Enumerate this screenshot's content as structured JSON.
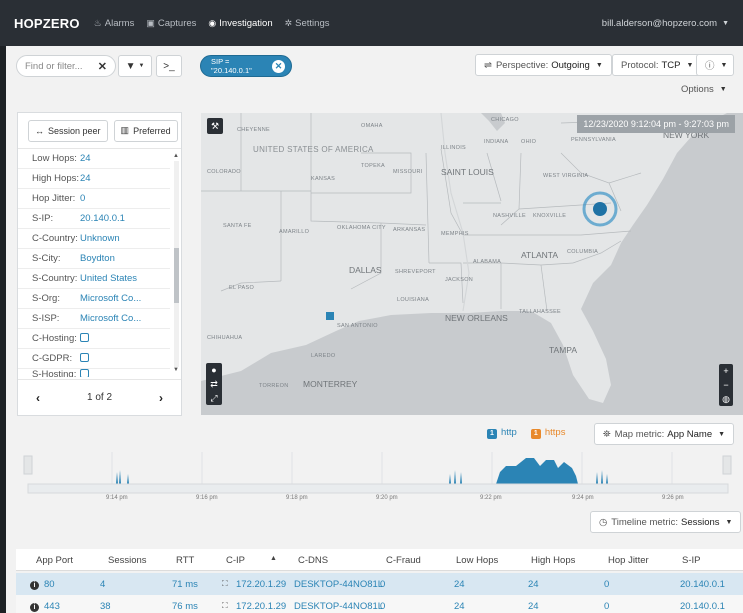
{
  "nav": {
    "brand": "HOPZERO",
    "items": [
      {
        "label": "Alarms",
        "icon": "fire-icon"
      },
      {
        "label": "Captures",
        "icon": "camera-icon"
      },
      {
        "label": "Investigation",
        "icon": "location-pin-icon",
        "active": true
      },
      {
        "label": "Settings",
        "icon": "gear-icon"
      }
    ],
    "user": "bill.alderson@hopzero.com"
  },
  "toolbar": {
    "filter_placeholder": "Find or filter...",
    "filter_chip": "SIP = \"20.140.0.1\"",
    "perspective_label": "Perspective:",
    "perspective_value": "Outgoing",
    "protocol_label": "Protocol:",
    "protocol_value": "TCP",
    "options_label": "Options"
  },
  "props": {
    "session_peer_label": "Session peer",
    "preferred_label": "Preferred",
    "rows": [
      {
        "key": "Low Hops:",
        "value": "24"
      },
      {
        "key": "High Hops:",
        "value": "24"
      },
      {
        "key": "Hop Jitter:",
        "value": "0"
      },
      {
        "key": "S-IP:",
        "value": "20.140.0.1"
      },
      {
        "key": "C-Country:",
        "value": "Unknown"
      },
      {
        "key": "S-City:",
        "value": "Boydton"
      },
      {
        "key": "S-Country:",
        "value": "United States"
      },
      {
        "key": "S-Org:",
        "value": "Microsoft Co..."
      },
      {
        "key": "S-ISP:",
        "value": "Microsoft Co..."
      },
      {
        "key": "C-Hosting:",
        "value": ""
      },
      {
        "key": "C-GDPR:",
        "value": ""
      },
      {
        "key": "S-Hosting:",
        "value": ""
      }
    ],
    "page_label": "1 of 2"
  },
  "map": {
    "time_range": "12/23/2020 9:12:04 pm - 9:27:03 pm",
    "labels": {
      "chicago": "CHICAGO",
      "cheyenne": "CHEYENNE",
      "omaha": "OMAHA",
      "united_states": "UNITED STATES OF AMERICA",
      "illinois": "ILLINOIS",
      "indiana": "INDIANA",
      "ohio": "OHIO",
      "pennsylvania": "PENNSYLVANIA",
      "new_york": "NEW YORK",
      "colorado": "COLORADO",
      "kansas": "KANSAS",
      "topeka": "TOPEKA",
      "missouri": "MISSOURI",
      "saint_louis": "SAINT LOUIS",
      "west_virginia": "WEST VIRGINIA",
      "santa_fe": "SANTA FE",
      "amarillo": "AMARILLO",
      "oklahoma_city": "OKLAHOMA CITY",
      "arkansas": "ARKANSAS",
      "memphis": "MEMPHIS",
      "nashville": "NASHVILLE",
      "knoxville": "KNOXVILLE",
      "atlanta": "ATLANTA",
      "columbia": "COLUMBIA",
      "dallas": "DALLAS",
      "shreveport": "SHREVEPORT",
      "jackson": "JACKSON",
      "alabama": "ALABAMA",
      "el_paso": "EL PASO",
      "louisiana": "LOUISIANA",
      "new_orleans": "NEW ORLEANS",
      "tallahassee": "TALLAHASSEE",
      "san_antonio": "SAN ANTONIO",
      "laredo": "LAREDO",
      "tampa": "TAMPA",
      "torreon": "TORREON",
      "monterrey": "MONTERREY",
      "chihuahua": "CHIHUAHUA"
    }
  },
  "legend": {
    "http_label": "http",
    "https_label": "https",
    "http_color": "#2b84b5",
    "https_color": "#e8892b",
    "map_metric_label": "Map metric:",
    "map_metric_value": "App Name"
  },
  "timeline": {
    "ticks": [
      "9:14 pm",
      "9:16 pm",
      "9:18 pm",
      "9:20 pm",
      "9:22 pm",
      "9:24 pm",
      "9:26 pm"
    ],
    "metric_label": "Timeline metric:",
    "metric_value": "Sessions"
  },
  "table": {
    "headers": [
      "App Port",
      "Sessions",
      "RTT",
      "C-IP",
      "C-DNS",
      "C-Fraud",
      "Low Hops",
      "High Hops",
      "Hop Jitter",
      "S-IP"
    ],
    "rows": [
      [
        "80",
        "4",
        "71 ms",
        "172.20.1.29",
        "DESKTOP-44NO81L",
        "0",
        "24",
        "24",
        "0",
        "20.140.0.1"
      ],
      [
        "443",
        "38",
        "76 ms",
        "172.20.1.29",
        "DESKTOP-44NO81L",
        "0",
        "24",
        "24",
        "0",
        "20.140.0.1"
      ]
    ]
  }
}
